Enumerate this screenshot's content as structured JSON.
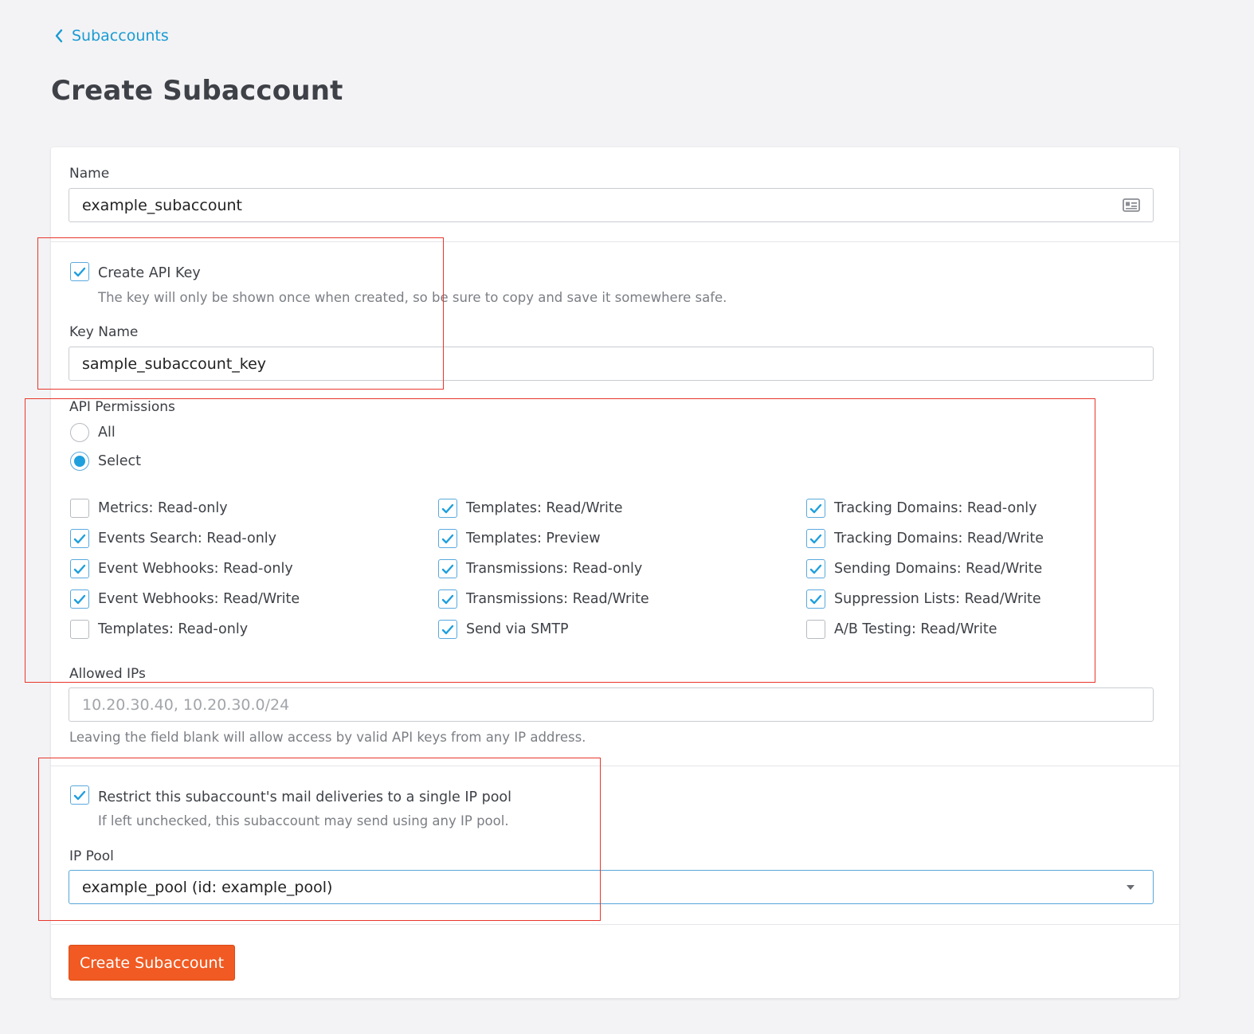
{
  "breadcrumb": {
    "label": "Subaccounts"
  },
  "page_title": "Create Subaccount",
  "name_field": {
    "label": "Name",
    "value": "example_subaccount"
  },
  "api_key": {
    "checkbox_label": "Create API Key",
    "checked": true,
    "help": "The key will only be shown once when created, so be sure to copy and save it somewhere safe.",
    "key_name_label": "Key Name",
    "key_name_value": "sample_subaccount_key"
  },
  "permissions": {
    "label": "API Permissions",
    "radio_all": "All",
    "radio_select": "Select",
    "selected": "Select",
    "items": [
      {
        "label": "Metrics: Read-only",
        "checked": false
      },
      {
        "label": "Events Search: Read-only",
        "checked": true
      },
      {
        "label": "Event Webhooks: Read-only",
        "checked": true
      },
      {
        "label": "Event Webhooks: Read/Write",
        "checked": true
      },
      {
        "label": "Templates: Read-only",
        "checked": false
      },
      {
        "label": "Templates: Read/Write",
        "checked": true
      },
      {
        "label": "Templates: Preview",
        "checked": true
      },
      {
        "label": "Transmissions: Read-only",
        "checked": true
      },
      {
        "label": "Transmissions: Read/Write",
        "checked": true
      },
      {
        "label": "Send via SMTP",
        "checked": true
      },
      {
        "label": "Tracking Domains: Read-only",
        "checked": true
      },
      {
        "label": "Tracking Domains: Read/Write",
        "checked": true
      },
      {
        "label": "Sending Domains: Read/Write",
        "checked": true
      },
      {
        "label": "Suppression Lists: Read/Write",
        "checked": true
      },
      {
        "label": "A/B Testing: Read/Write",
        "checked": false
      }
    ]
  },
  "allowed_ips": {
    "label": "Allowed IPs",
    "placeholder": "10.20.30.40, 10.20.30.0/24",
    "help": "Leaving the field blank will allow access by valid API keys from any IP address."
  },
  "ip_pool": {
    "checkbox_label": "Restrict this subaccount's mail deliveries to a single IP pool",
    "checked": true,
    "help": "If left unchecked, this subaccount may send using any IP pool.",
    "label": "IP Pool",
    "value": "example_pool (id: example_pool)"
  },
  "submit": {
    "label": "Create Subaccount"
  },
  "colors": {
    "accent": "#1a9bd3",
    "button": "#f15a22",
    "highlight": "#e8372c"
  }
}
